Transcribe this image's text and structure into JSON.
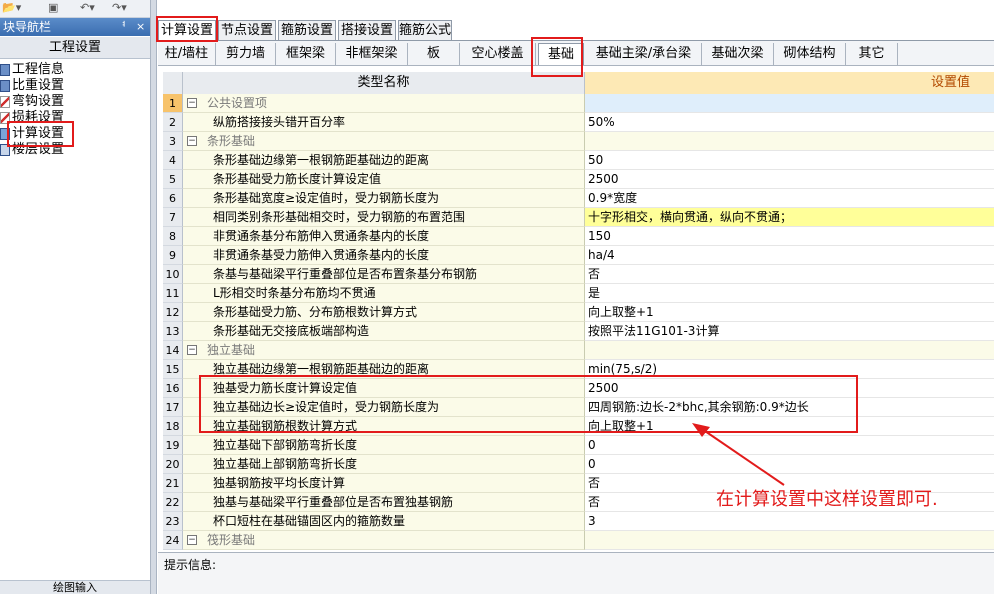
{
  "nav": {
    "title": "块导航栏",
    "pin": "ᅧ",
    "close": "×",
    "section": "工程设置",
    "items": [
      "工程信息",
      "比重设置",
      "弯钩设置",
      "损耗设置",
      "计算设置",
      "楼层设置"
    ],
    "bottom": "绘图输入"
  },
  "top_tabs": [
    "计算设置",
    "节点设置",
    "箍筋设置",
    "搭接设置",
    "箍筋公式"
  ],
  "sub_tabs": [
    "柱/墙柱",
    "剪力墙",
    "框架梁",
    "非框架梁",
    "板",
    "空心楼盖",
    "基础",
    "基础主梁/承台梁",
    "基础次梁",
    "砌体结构",
    "其它"
  ],
  "grid": {
    "header_name": "类型名称",
    "header_value": "设置值",
    "rows": [
      {
        "num": "1",
        "name": "公共设置项",
        "value": "",
        "group": true
      },
      {
        "num": "2",
        "name": "纵筋搭接接头错开百分率",
        "value": "50%"
      },
      {
        "num": "3",
        "name": "条形基础",
        "value": "",
        "group": true
      },
      {
        "num": "4",
        "name": "条形基础边缘第一根钢筋距基础边的距离",
        "value": "50"
      },
      {
        "num": "5",
        "name": "条形基础受力筋长度计算设定值",
        "value": "2500"
      },
      {
        "num": "6",
        "name": "条形基础宽度≥设定值时，受力钢筋长度为",
        "value": "0.9*宽度"
      },
      {
        "num": "7",
        "name": "相同类别条形基础相交时，受力钢筋的布置范围",
        "value": "十字形相交，横向贯通，纵向不贯通；"
      },
      {
        "num": "8",
        "name": "非贯通条基分布筋伸入贯通条基内的长度",
        "value": "150"
      },
      {
        "num": "9",
        "name": "非贯通条基受力筋伸入贯通条基内的长度",
        "value": "ha/4"
      },
      {
        "num": "10",
        "name": "条基与基础梁平行重叠部位是否布置条基分布钢筋",
        "value": "否"
      },
      {
        "num": "11",
        "name": "L形相交时条基分布筋均不贯通",
        "value": "是"
      },
      {
        "num": "12",
        "name": "条形基础受力筋、分布筋根数计算方式",
        "value": "向上取整+1"
      },
      {
        "num": "13",
        "name": "条形基础无交接底板端部构造",
        "value": "按照平法11G101-3计算"
      },
      {
        "num": "14",
        "name": "独立基础",
        "value": "",
        "group": true
      },
      {
        "num": "15",
        "name": "独立基础边缘第一根钢筋距基础边的距离",
        "value": "min(75,s/2)"
      },
      {
        "num": "16",
        "name": "独基受力筋长度计算设定值",
        "value": "2500"
      },
      {
        "num": "17",
        "name": "独立基础边长≥设定值时，受力钢筋长度为",
        "value": "四周钢筋:边长-2*bhc,其余钢筋:0.9*边长"
      },
      {
        "num": "18",
        "name": "独立基础钢筋根数计算方式",
        "value": "向上取整+1"
      },
      {
        "num": "19",
        "name": "独立基础下部钢筋弯折长度",
        "value": "0"
      },
      {
        "num": "20",
        "name": "独立基础上部钢筋弯折长度",
        "value": "0"
      },
      {
        "num": "21",
        "name": "独基钢筋按平均长度计算",
        "value": "否"
      },
      {
        "num": "22",
        "name": "独基与基础梁平行重叠部位是否布置独基钢筋",
        "value": "否"
      },
      {
        "num": "23",
        "name": "杯口短柱在基础锚固区内的箍筋数量",
        "value": "3"
      },
      {
        "num": "24",
        "name": "筏形基础",
        "value": "",
        "group": true
      }
    ]
  },
  "tip_label": "提示信息:",
  "annotation": "在计算设置中这样设置即可.",
  "colors": {
    "annotation": "#e21b1b",
    "header_value_bg": "#fde9b5",
    "row_name_bg": "#fbfbe8",
    "highlight": "#ffff99"
  }
}
